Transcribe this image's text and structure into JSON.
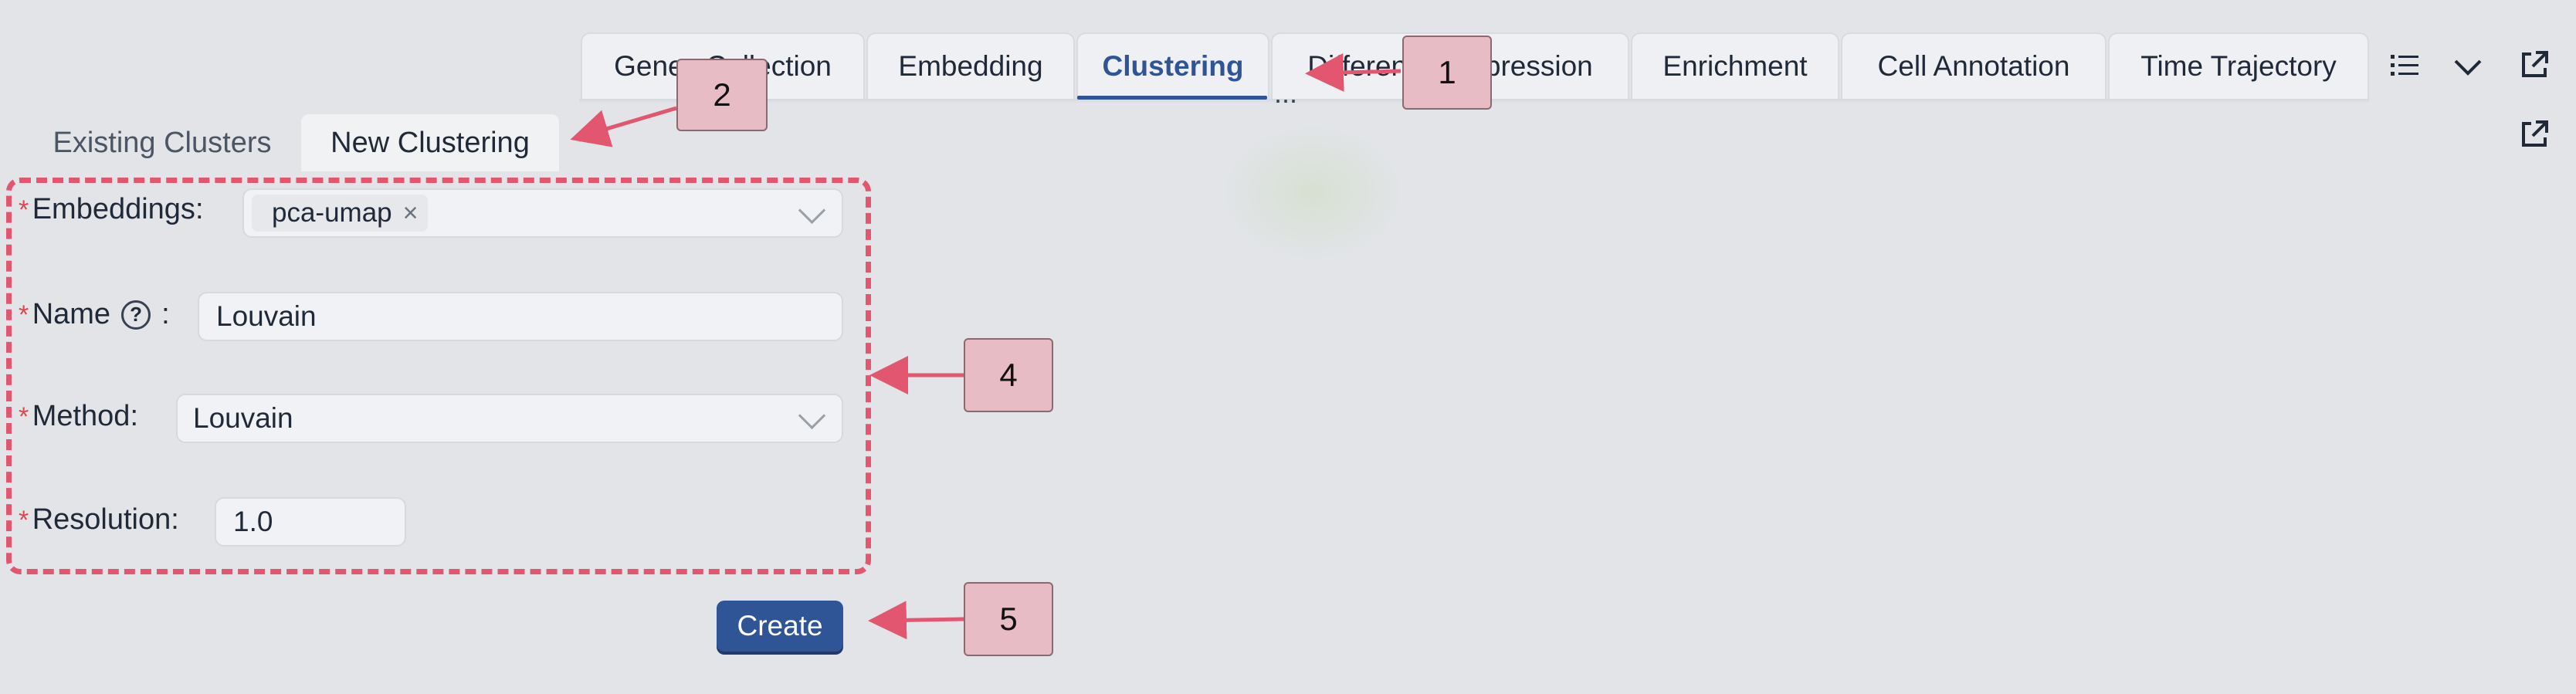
{
  "top_tabs": [
    {
      "label": "Genes Collection"
    },
    {
      "label": "Embedding"
    },
    {
      "label": "Clustering"
    },
    {
      "label": "Differential Expression"
    },
    {
      "label": "Enrichment"
    },
    {
      "label": "Cell Annotation"
    },
    {
      "label": "Time Trajectory"
    }
  ],
  "top_tabs_overflow": "...",
  "toolbar_icons": [
    "list-icon",
    "chevron-down-icon",
    "open-external-icon"
  ],
  "sub_tabs": [
    {
      "label": "Existing Clusters"
    },
    {
      "label": "New Clustering"
    }
  ],
  "form": {
    "required_mark": "*",
    "embeddings": {
      "label": "Embeddings",
      "separator": ":",
      "tag": "pca-umap",
      "tag_remove": "×"
    },
    "name": {
      "label": "Name",
      "separator": ":",
      "help": "?",
      "value": "Louvain"
    },
    "method": {
      "label": "Method",
      "separator": ":",
      "value": "Louvain"
    },
    "resolution": {
      "label": "Resolution",
      "separator": ":",
      "value": "1.0"
    }
  },
  "create_label": "Create",
  "annotations": {
    "c1": "1",
    "c2": "2",
    "c4": "4",
    "c5": "5"
  },
  "colors": {
    "accent": "#2f5597",
    "annotation": "#e25670",
    "required": "#e0454f"
  }
}
